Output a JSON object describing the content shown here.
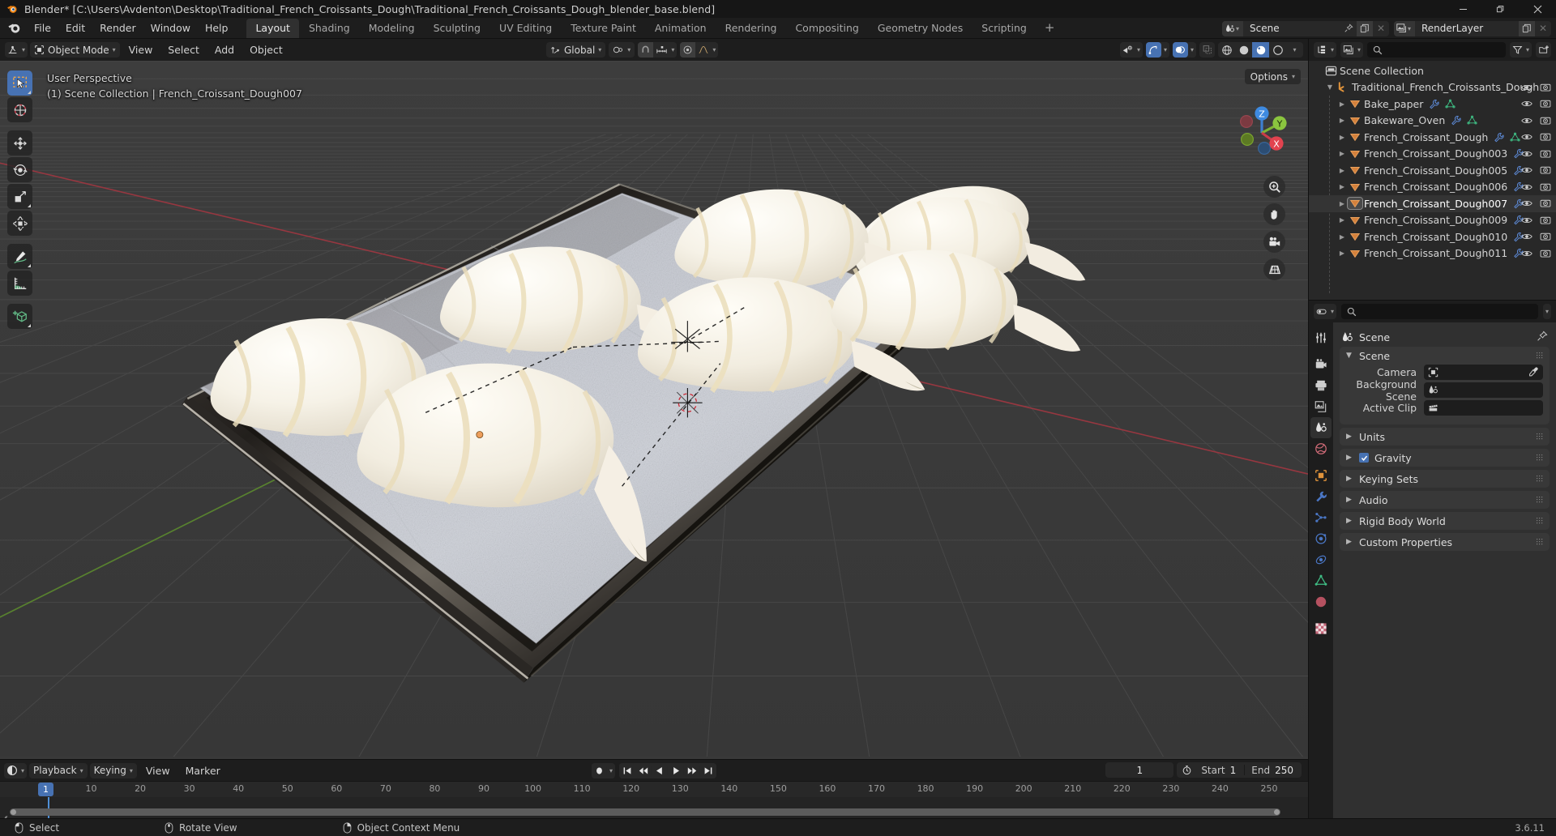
{
  "window": {
    "title": "Blender* [C:\\Users\\Avdenton\\Desktop\\Traditional_French_Croissants_Dough\\Traditional_French_Croissants_Dough_blender_base.blend]",
    "minimize": "—",
    "maximize": "❐",
    "close": "✕"
  },
  "topbar": {
    "menus": [
      "File",
      "Edit",
      "Render",
      "Window",
      "Help"
    ],
    "workspaces": [
      {
        "label": "Layout",
        "active": true
      },
      {
        "label": "Shading",
        "active": false
      },
      {
        "label": "Modeling",
        "active": false
      },
      {
        "label": "Sculpting",
        "active": false
      },
      {
        "label": "UV Editing",
        "active": false
      },
      {
        "label": "Texture Paint",
        "active": false
      },
      {
        "label": "Animation",
        "active": false
      },
      {
        "label": "Rendering",
        "active": false
      },
      {
        "label": "Compositing",
        "active": false
      },
      {
        "label": "Geometry Nodes",
        "active": false
      },
      {
        "label": "Scripting",
        "active": false
      }
    ],
    "add_workspace": "+",
    "scene_name": "Scene",
    "viewlayer_name": "RenderLayer"
  },
  "viewport_header": {
    "mode": "Object Mode",
    "menus": [
      "View",
      "Select",
      "Add",
      "Object"
    ],
    "transform_orientation": "Global",
    "options_label": "Options"
  },
  "viewport": {
    "perspective": "User Perspective",
    "collection_line": "(1) Scene Collection | French_Croissant_Dough007",
    "gizmo_axes": [
      "X",
      "Y",
      "Z"
    ],
    "colors": {
      "x_axis": "#cd3a4a",
      "y_axis": "#87c440",
      "z_axis": "#2f83e3",
      "background": "#393939",
      "accent": "#4772b3",
      "active_object": "#ed9e5c"
    }
  },
  "outliner": {
    "search_placeholder": "",
    "rows": [
      {
        "label": "Scene Collection",
        "indent": 0,
        "icon": "collection-icon",
        "disclosure": "",
        "mods": [],
        "vis": false
      },
      {
        "label": "Traditional_French_Croissants_Dough",
        "indent": 1,
        "icon": "collection-group-icon",
        "disclosure": "▼",
        "mods": [],
        "vis": true
      },
      {
        "label": "Bake_paper",
        "indent": 2,
        "icon": "mesh-object-icon",
        "disclosure": "▶",
        "mods": [
          "modifier-icon",
          "mesh-data-icon"
        ],
        "vis": true
      },
      {
        "label": "Bakeware_Oven",
        "indent": 2,
        "icon": "mesh-object-icon",
        "disclosure": "▶",
        "mods": [
          "modifier-icon",
          "mesh-data-icon"
        ],
        "vis": true
      },
      {
        "label": "French_Croissant_Dough",
        "indent": 2,
        "icon": "mesh-object-icon",
        "disclosure": "▶",
        "mods": [
          "modifier-icon",
          "mesh-data-icon"
        ],
        "vis": true
      },
      {
        "label": "French_Croissant_Dough003",
        "indent": 2,
        "icon": "mesh-object-icon",
        "disclosure": "▶",
        "mods": [
          "modifier-icon"
        ],
        "vis": true
      },
      {
        "label": "French_Croissant_Dough005",
        "indent": 2,
        "icon": "mesh-object-icon",
        "disclosure": "▶",
        "mods": [
          "modifier-icon"
        ],
        "vis": true
      },
      {
        "label": "French_Croissant_Dough006",
        "indent": 2,
        "icon": "mesh-object-icon",
        "disclosure": "▶",
        "mods": [
          "modifier-icon"
        ],
        "vis": true
      },
      {
        "label": "French_Croissant_Dough007",
        "indent": 2,
        "icon": "mesh-object-icon",
        "disclosure": "▶",
        "mods": [
          "modifier-icon"
        ],
        "vis": true,
        "active": true
      },
      {
        "label": "French_Croissant_Dough009",
        "indent": 2,
        "icon": "mesh-object-icon",
        "disclosure": "▶",
        "mods": [
          "modifier-icon"
        ],
        "vis": true
      },
      {
        "label": "French_Croissant_Dough010",
        "indent": 2,
        "icon": "mesh-object-icon",
        "disclosure": "▶",
        "mods": [
          "modifier-icon"
        ],
        "vis": true
      },
      {
        "label": "French_Croissant_Dough011",
        "indent": 2,
        "icon": "mesh-object-icon",
        "disclosure": "▶",
        "mods": [
          "modifier-icon"
        ],
        "vis": true
      }
    ]
  },
  "properties": {
    "search_placeholder": "",
    "breadcrumb": "Scene",
    "panels": [
      {
        "title": "Scene",
        "open": true,
        "checkbox": false
      },
      {
        "title": "Units",
        "open": false,
        "checkbox": false
      },
      {
        "title": "Gravity",
        "open": false,
        "checkbox": true
      },
      {
        "title": "Keying Sets",
        "open": false,
        "checkbox": false
      },
      {
        "title": "Audio",
        "open": false,
        "checkbox": false
      },
      {
        "title": "Rigid Body World",
        "open": false,
        "checkbox": false
      },
      {
        "title": "Custom Properties",
        "open": false,
        "checkbox": false
      }
    ],
    "scene_fields": [
      {
        "label": "Camera",
        "value": "",
        "icon": "camera-icon",
        "eyedropper": true
      },
      {
        "label": "Background Scene",
        "value": "",
        "icon": "scene-icon",
        "eyedropper": false
      },
      {
        "label": "Active Clip",
        "value": "",
        "icon": "clip-icon",
        "eyedropper": false
      }
    ]
  },
  "timeline": {
    "menus": [
      "Playback",
      "Keying",
      "View",
      "Marker"
    ],
    "current_frame": "1",
    "start_label": "Start",
    "start_value": "1",
    "end_label": "End",
    "end_value": "250",
    "ruler_ticks": [
      "1",
      "10",
      "20",
      "30",
      "40",
      "50",
      "60",
      "70",
      "80",
      "90",
      "100",
      "110",
      "120",
      "130",
      "140",
      "150",
      "160",
      "170",
      "180",
      "190",
      "200",
      "210",
      "220",
      "230",
      "240",
      "250"
    ]
  },
  "statusbar": {
    "items": [
      {
        "icon": "mouse-left-icon",
        "label": "Select"
      },
      {
        "icon": "mouse-middle-icon",
        "label": "Rotate View"
      },
      {
        "icon": "mouse-right-icon",
        "label": "Object Context Menu"
      }
    ],
    "version": "3.6.11"
  }
}
